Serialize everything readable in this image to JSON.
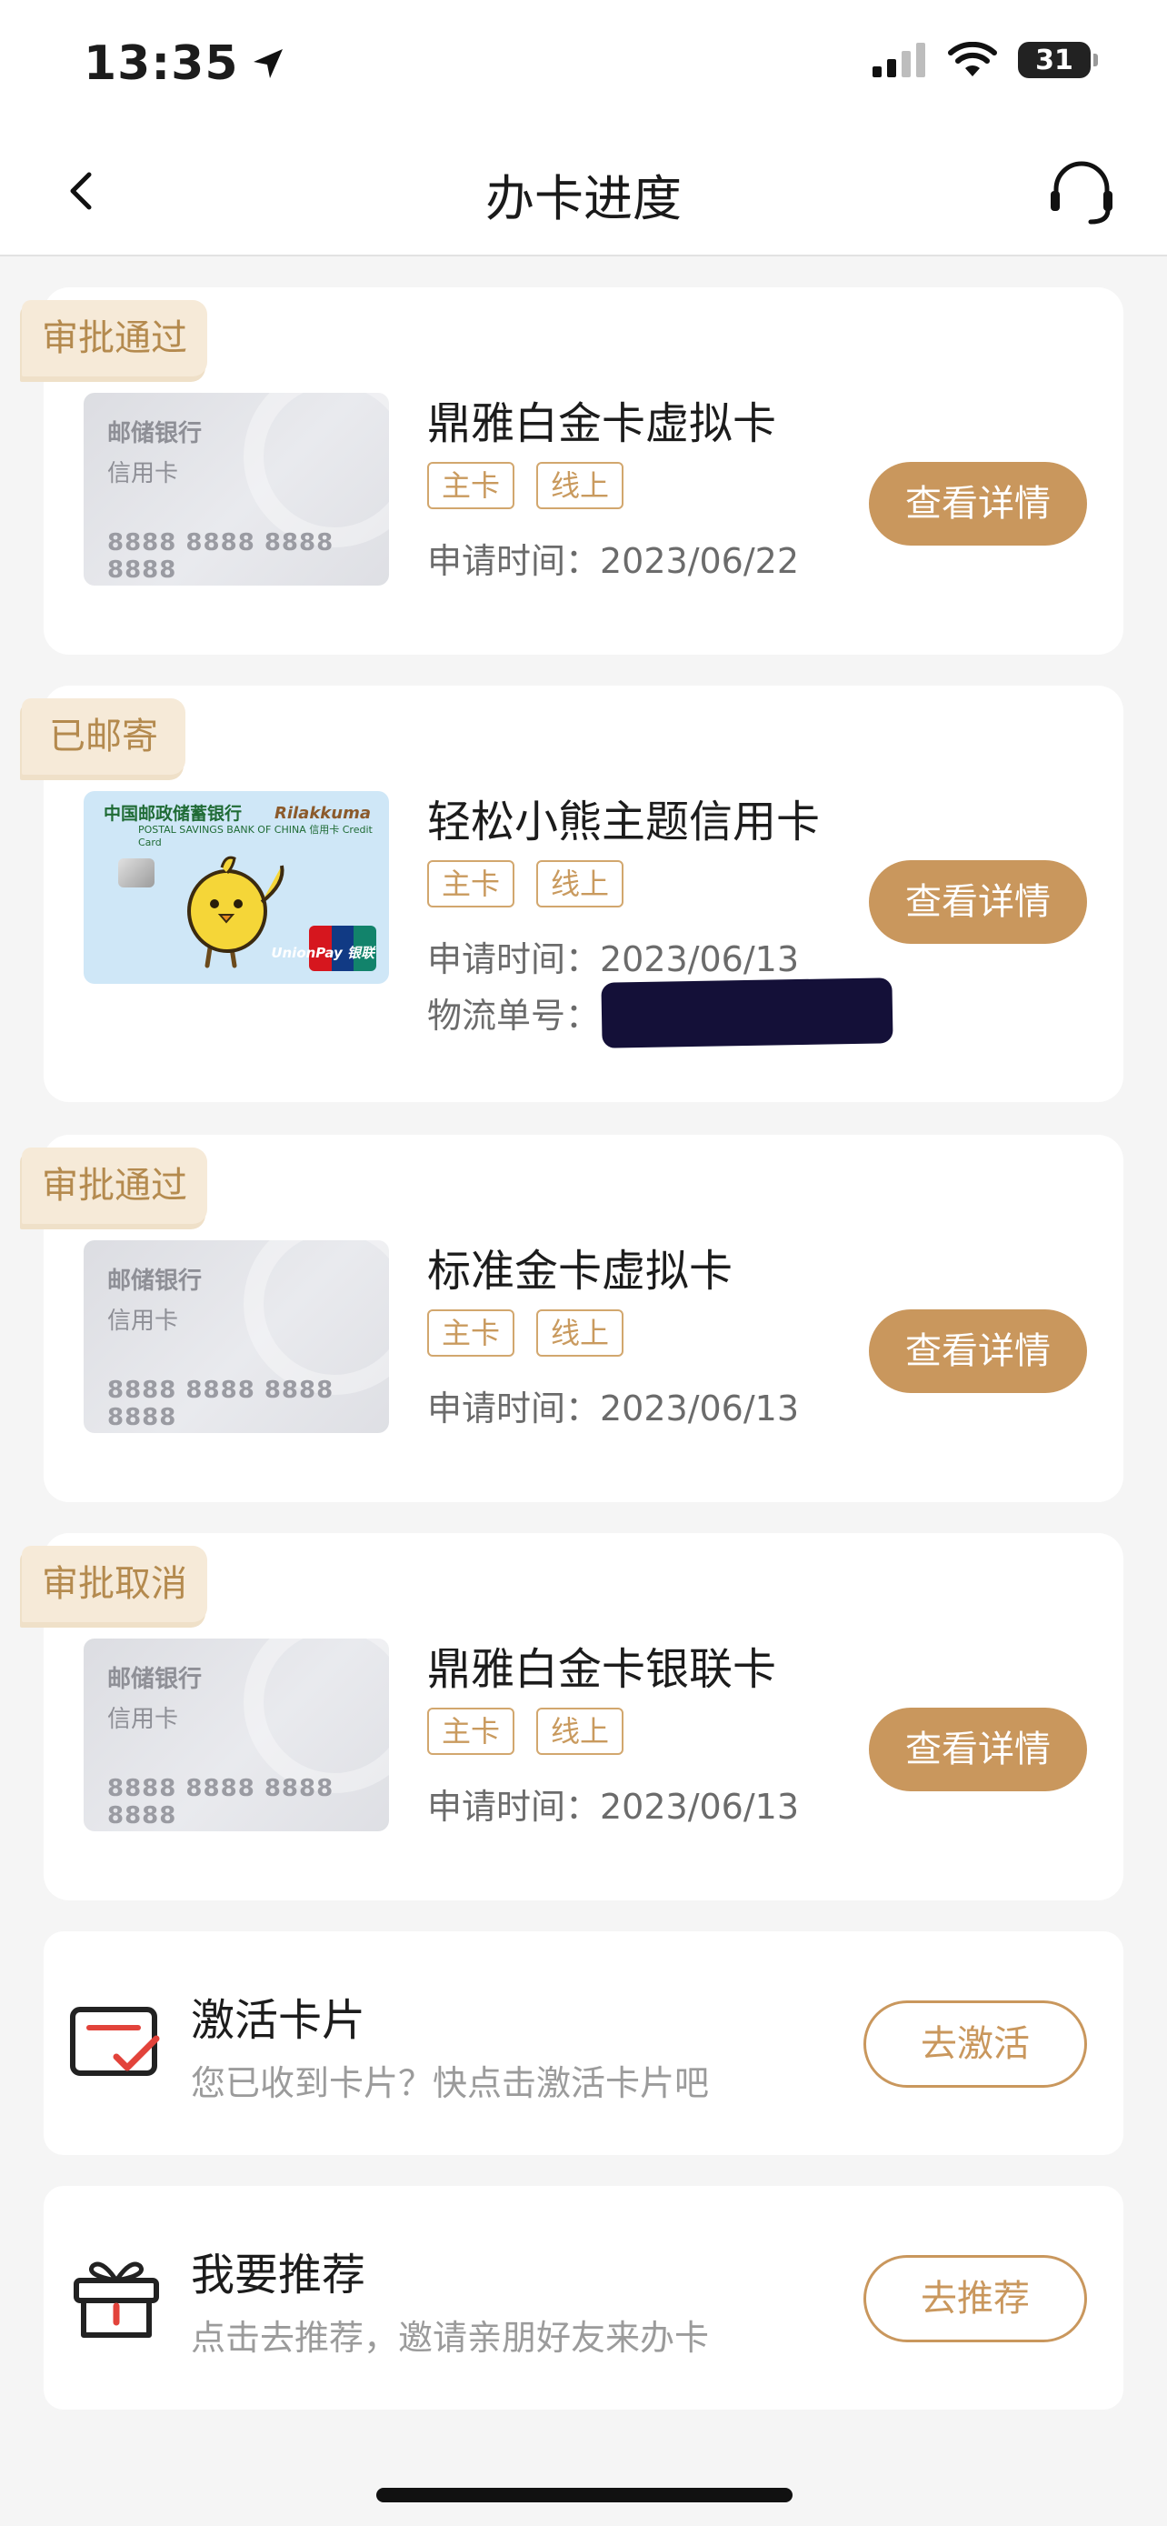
{
  "status_bar": {
    "time": "13:35",
    "battery": "31"
  },
  "nav": {
    "title": "办卡进度"
  },
  "applications": [
    {
      "status": "审批通过",
      "card_face": {
        "bank": "邮储银行",
        "type": "信用卡",
        "number": "8888 8888 8888 8888"
      },
      "name": "鼎雅白金卡虚拟卡",
      "tags": [
        "主卡",
        "线上"
      ],
      "apply_time": "申请时间：2023/06/22",
      "button": "查看详情"
    },
    {
      "status": "已邮寄",
      "card_face": {
        "bank": "中国邮政储蓄银行",
        "subtitle": "POSTAL SAVINGS BANK OF CHINA  信用卡 Credit Card",
        "brand": "Rilakkuma",
        "network": "UnionPay 银联"
      },
      "name": "轻松小熊主题信用卡",
      "tags": [
        "主卡",
        "线上"
      ],
      "apply_time": "申请时间：2023/06/13",
      "tracking_label": "物流单号：",
      "button": "查看详情"
    },
    {
      "status": "审批通过",
      "card_face": {
        "bank": "邮储银行",
        "type": "信用卡",
        "number": "8888 8888 8888 8888"
      },
      "name": "标准金卡虚拟卡",
      "tags": [
        "主卡",
        "线上"
      ],
      "apply_time": "申请时间：2023/06/13",
      "button": "查看详情"
    },
    {
      "status": "审批取消",
      "card_face": {
        "bank": "邮储银行",
        "type": "信用卡",
        "number": "8888 8888 8888 8888"
      },
      "name": "鼎雅白金卡银联卡",
      "tags": [
        "主卡",
        "线上"
      ],
      "apply_time": "申请时间：2023/06/13",
      "button": "查看详情"
    }
  ],
  "activate": {
    "title": "激活卡片",
    "desc": "您已收到卡片？快点击激活卡片吧",
    "button": "去激活"
  },
  "recommend": {
    "title": "我要推荐",
    "desc": "点击去推荐，邀请亲朋好友来办卡",
    "button": "去推荐"
  },
  "colors": {
    "accent": "#c9975d",
    "tag_bg": "#f6ead8",
    "tag_text": "#b48a4e",
    "page_bg": "#f5f5f5"
  }
}
